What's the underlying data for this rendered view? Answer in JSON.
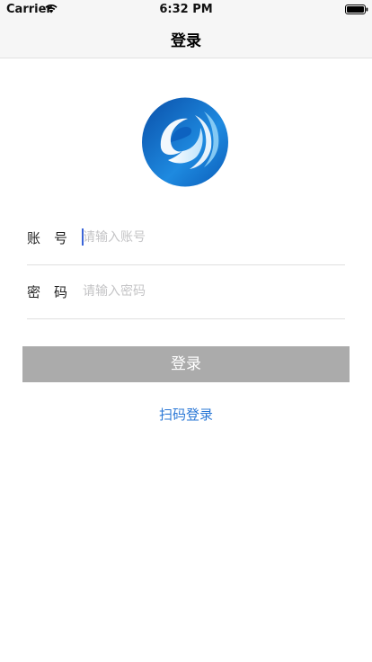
{
  "status_bar": {
    "carrier": "Carrier",
    "time": "6:32 PM",
    "wifi_icon": "wifi-icon",
    "battery_icon": "battery-icon"
  },
  "nav": {
    "title": "登录"
  },
  "logo": {
    "icon": "app-logo-e",
    "colors": [
      "#0a4fa8",
      "#1e8ae0",
      "#6fc3f2"
    ]
  },
  "form": {
    "account": {
      "label": "账　号",
      "placeholder": "请输入账号",
      "value": ""
    },
    "password": {
      "label": "密　码",
      "placeholder": "请输入密码",
      "value": ""
    }
  },
  "login_button": {
    "label": "登录",
    "color": "#ababab"
  },
  "scan_login": {
    "label": "扫码登录",
    "color": "#2b78d6"
  }
}
